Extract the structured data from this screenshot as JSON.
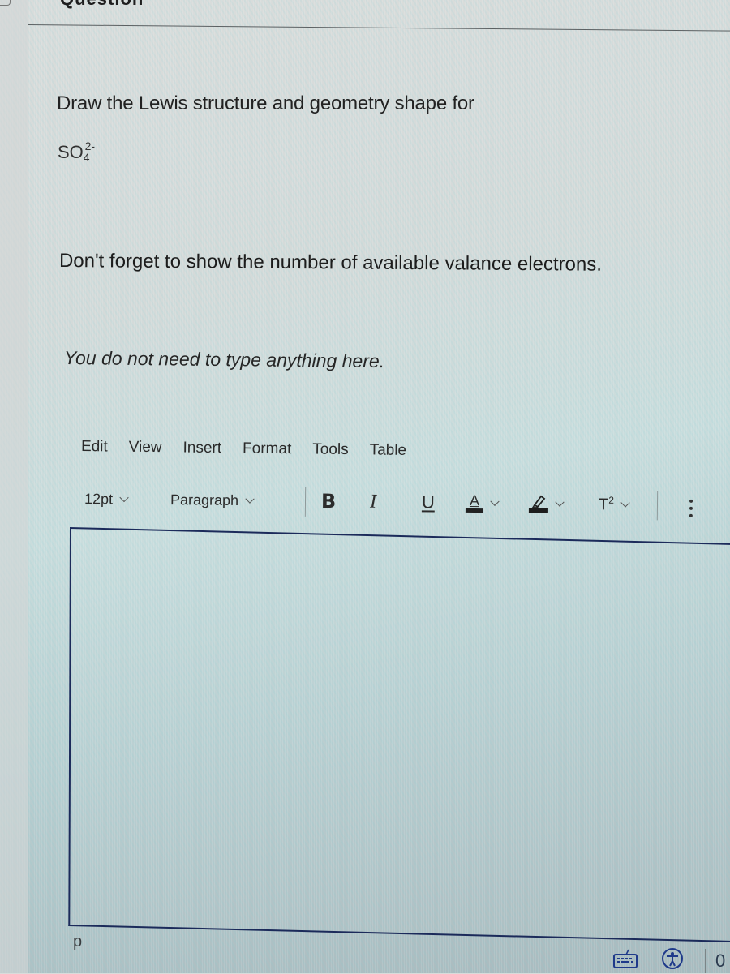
{
  "header": {
    "section_title": "Question"
  },
  "question": {
    "prompt": "Draw the Lewis structure and geometry shape for",
    "formula": {
      "base": "SO",
      "subscript": "4",
      "superscript": "2-"
    },
    "reminder": "Don't forget to show the number of available valance electrons.",
    "note": "You do not need to type anything here."
  },
  "editor": {
    "menubar": [
      {
        "label": "Edit"
      },
      {
        "label": "View"
      },
      {
        "label": "Insert"
      },
      {
        "label": "Format"
      },
      {
        "label": "Tools"
      },
      {
        "label": "Table"
      }
    ],
    "toolbar": {
      "font_size": "12pt",
      "block_format": "Paragraph",
      "bold_label": "B",
      "italic_label": "I",
      "underline_label": "U",
      "text_color_label": "A",
      "superscript_label": "T",
      "superscript_mark": "2",
      "icons": {
        "text_color": "text-color-icon",
        "highlight": "highlighter-icon",
        "superscript": "superscript-icon",
        "more": "more-vertical-icon"
      }
    },
    "content": "",
    "status_bar": {
      "element_path": "p",
      "word_count": "0",
      "icons": {
        "keyboard": "keyboard-icon",
        "accessibility": "accessibility-icon"
      }
    }
  },
  "colors": {
    "editor_border": "#1b2a5a",
    "status_icon": "#1f3a8a"
  }
}
